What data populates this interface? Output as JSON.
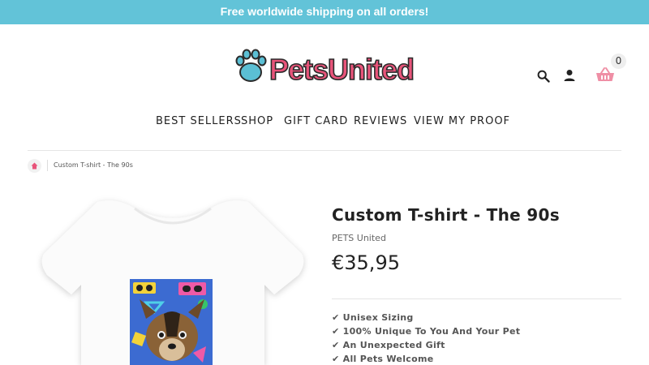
{
  "announcement": {
    "text": "Free worldwide shipping on all orders!",
    "bg_color": "#62c3d8"
  },
  "brand": {
    "logo_text": "PetsUnited",
    "logo_color": "#e8547a",
    "paw_color": "#5bbfd4"
  },
  "header": {
    "icons": [
      "search-icon",
      "account-icon",
      "basket-icon"
    ],
    "cart_count": "0",
    "cart_color": "#ef8fa5"
  },
  "nav": {
    "items": [
      {
        "label": "BEST SELLERS"
      },
      {
        "label": "SHOP"
      },
      {
        "label": "GIFT CARD"
      },
      {
        "label": "REVIEWS"
      },
      {
        "label": "VIEW MY PROOF"
      }
    ]
  },
  "breadcrumb": {
    "home_icon": "home-icon",
    "current": "Custom T-shirt - The 90s"
  },
  "product": {
    "title": "Custom T-shirt - The 90s",
    "vendor": "PETS United",
    "price": "€35,95",
    "features": [
      "✔ Unisex Sizing",
      "✔ 100% Unique To You And Your Pet",
      "✔ An Unexpected Gift",
      "✔ All Pets Welcome"
    ]
  }
}
